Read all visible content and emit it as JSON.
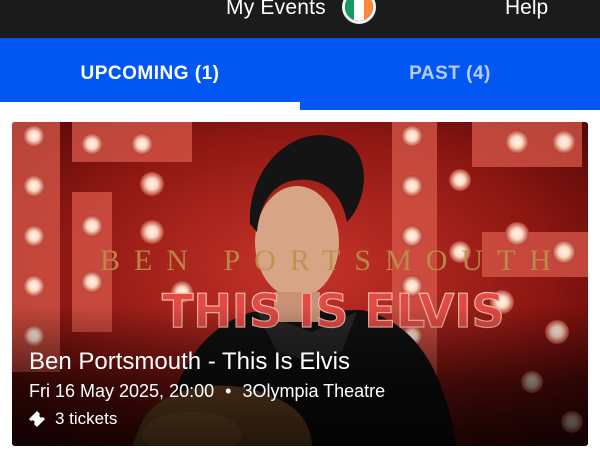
{
  "header": {
    "title": "My Events",
    "help_label": "Help",
    "flag_icon": "ireland-flag-icon",
    "flag_colors": [
      "#169b62",
      "#ffffff",
      "#ff883e"
    ]
  },
  "tabs": [
    {
      "label": "UPCOMING (1)",
      "active": true
    },
    {
      "label": "PAST (4)",
      "active": false
    }
  ],
  "colors": {
    "topbar": "#1b1b1b",
    "accent": "#0257f2",
    "inactive_tab_text": "#b7ccff"
  },
  "event": {
    "title": "Ben Portsmouth - This Is Elvis",
    "datetime": "Fri 16 May 2025, 20:00",
    "separator": "•",
    "venue": "3Olympia Theatre",
    "tickets": "3 tickets",
    "ticket_icon": "ticket-icon",
    "poster": {
      "performer_line": "BEN PORTSMOUTH",
      "show_line": "THIS IS ELVIS",
      "marquee_text": "ELVIS"
    }
  }
}
